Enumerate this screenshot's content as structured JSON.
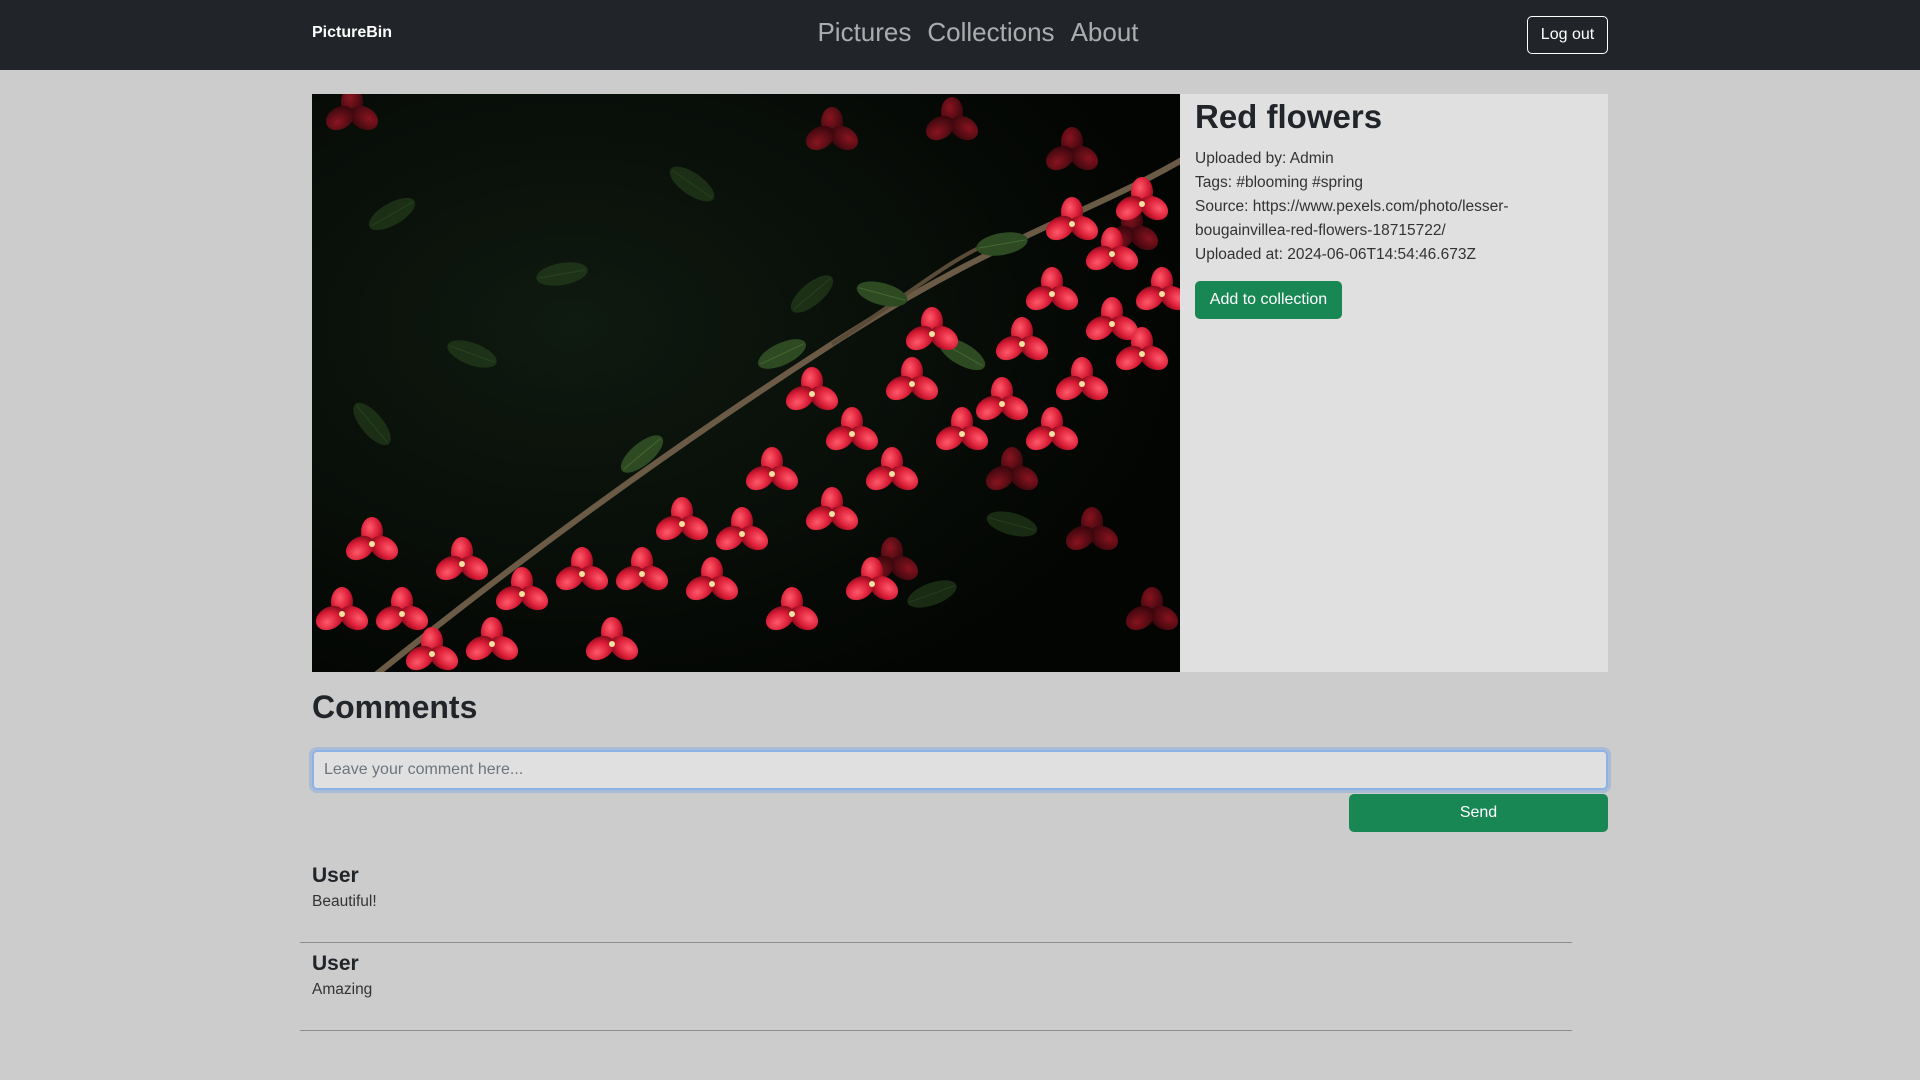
{
  "navbar": {
    "brand": "PictureBin",
    "links": [
      "Pictures",
      "Collections",
      "About"
    ],
    "logout_label": "Log out"
  },
  "picture": {
    "alt": "Red bougainvillea flowers",
    "title": "Red flowers",
    "uploaded_by": "Uploaded by: Admin",
    "tags": "Tags: #blooming #spring",
    "source_line1": "Source: https://www.pexels.com/photo/lesser-",
    "source_line2": "bougainvillea-red-flowers-18715722/",
    "uploaded_at": "Uploaded at: 2024-06-06T14:54:46.673Z",
    "add_button": "Add to collection"
  },
  "comments": {
    "heading": "Comments",
    "input_placeholder": "Leave your comment here...",
    "send_label": "Send",
    "items": [
      {
        "user": "User",
        "text": "Beautiful!"
      },
      {
        "user": "User",
        "text": "Amazing"
      }
    ]
  },
  "colors": {
    "navbar": "#212529",
    "background": "#cccccc",
    "panel": "#e0e0e0",
    "success": "#198754"
  }
}
